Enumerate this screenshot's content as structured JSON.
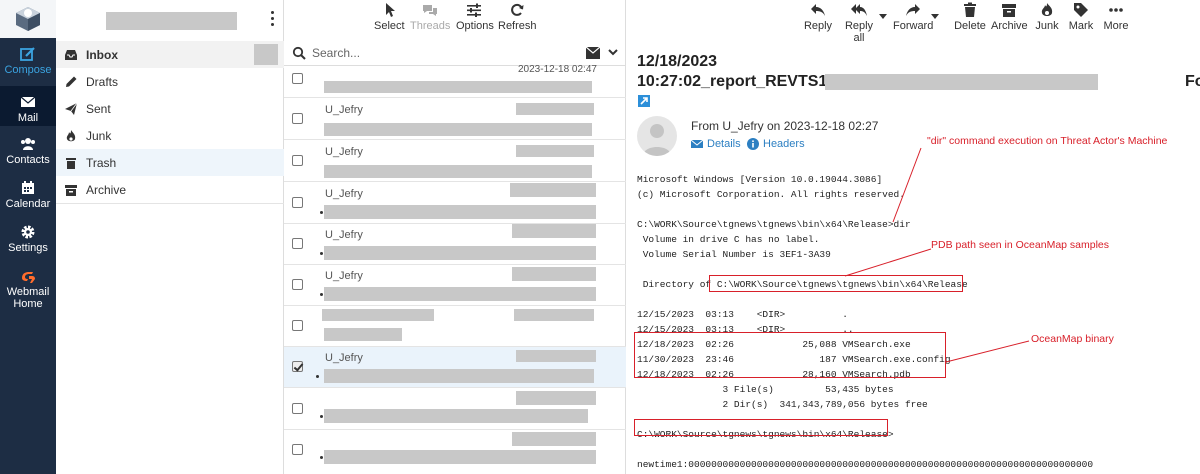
{
  "nav": {
    "items": [
      {
        "label": "Compose",
        "icon": "compose-icon"
      },
      {
        "label": "Mail",
        "icon": "mail-icon"
      },
      {
        "label": "Contacts",
        "icon": "contacts-icon"
      },
      {
        "label": "Calendar",
        "icon": "calendar-icon"
      },
      {
        "label": "Settings",
        "icon": "settings-icon"
      },
      {
        "label": "Webmail Home",
        "icon": "cpanel-icon"
      }
    ]
  },
  "folders": {
    "items": [
      {
        "label": "Inbox",
        "icon": "inbox-icon"
      },
      {
        "label": "Drafts",
        "icon": "pencil-icon"
      },
      {
        "label": "Sent",
        "icon": "paper-plane-icon"
      },
      {
        "label": "Junk",
        "icon": "fire-icon"
      },
      {
        "label": "Trash",
        "icon": "trash-icon"
      },
      {
        "label": "Archive",
        "icon": "archive-icon"
      }
    ]
  },
  "list_toolbar": {
    "select": "Select",
    "threads": "Threads",
    "options": "Options",
    "refresh": "Refresh"
  },
  "search": {
    "placeholder": "Search..."
  },
  "messages": {
    "partial_date": "2023-12-18 02:47",
    "sender": "U_Jefry"
  },
  "reader_toolbar": {
    "reply": "Reply",
    "reply_all": "Reply all",
    "forward": "Forward",
    "delete": "Delete",
    "archive": "Archive",
    "junk": "Junk",
    "mark": "Mark",
    "more": "More"
  },
  "reader": {
    "subject_line1": "12/18/2023",
    "subject_line2_prefix": "10:27:02_report_REVTS1",
    "subject_line2_suffix": "Fo",
    "from": "From U_Jefry on 2023-12-18 02:27",
    "details": "Details",
    "headers": "Headers",
    "body": {
      "l1": "Microsoft Windows [Version 10.0.19044.3086]",
      "l2": "(c) Microsoft Corporation. All rights reserved.",
      "l3": "",
      "l4": "C:\\WORK\\Source\\tgnews\\tgnews\\bin\\x64\\Release>dir",
      "l5": " Volume in drive C has no label.",
      "l6": " Volume Serial Number is 3EF1-3A39",
      "l7": "",
      "l8": " Directory of C:\\WORK\\Source\\tgnews\\tgnews\\bin\\x64\\Release",
      "l9": "",
      "l10": "12/15/2023  03:13    <DIR>          .",
      "l11": "12/15/2023  03:13    <DIR>          ..",
      "l12": "12/18/2023  02:26            25,088 VMSearch.exe",
      "l13": "11/30/2023  23:46               187 VMSearch.exe.config",
      "l14": "12/18/2023  02:26            28,160 VMSearch.pdb",
      "l15": "               3 File(s)         53,435 bytes",
      "l16": "               2 Dir(s)  341,343,789,056 bytes free",
      "l17": "",
      "l18": "C:\\WORK\\Source\\tgnews\\tgnews\\bin\\x64\\Release>",
      "l19": "",
      "l20": "newtime1:00000000000000000000000000000000000000000000000000000000000000000000000"
    },
    "annotations": {
      "dir": "\"dir\" command execution on Threat Actor's Machine",
      "pdb": "PDB path seen in OceanMap samples",
      "binary": "OceanMap binary"
    }
  },
  "colors": {
    "rail_bg": "#1d2d44",
    "accent": "#2c8fd9",
    "annotation_red": "#d8202a",
    "cpanel_orange": "#ff6c2c"
  }
}
